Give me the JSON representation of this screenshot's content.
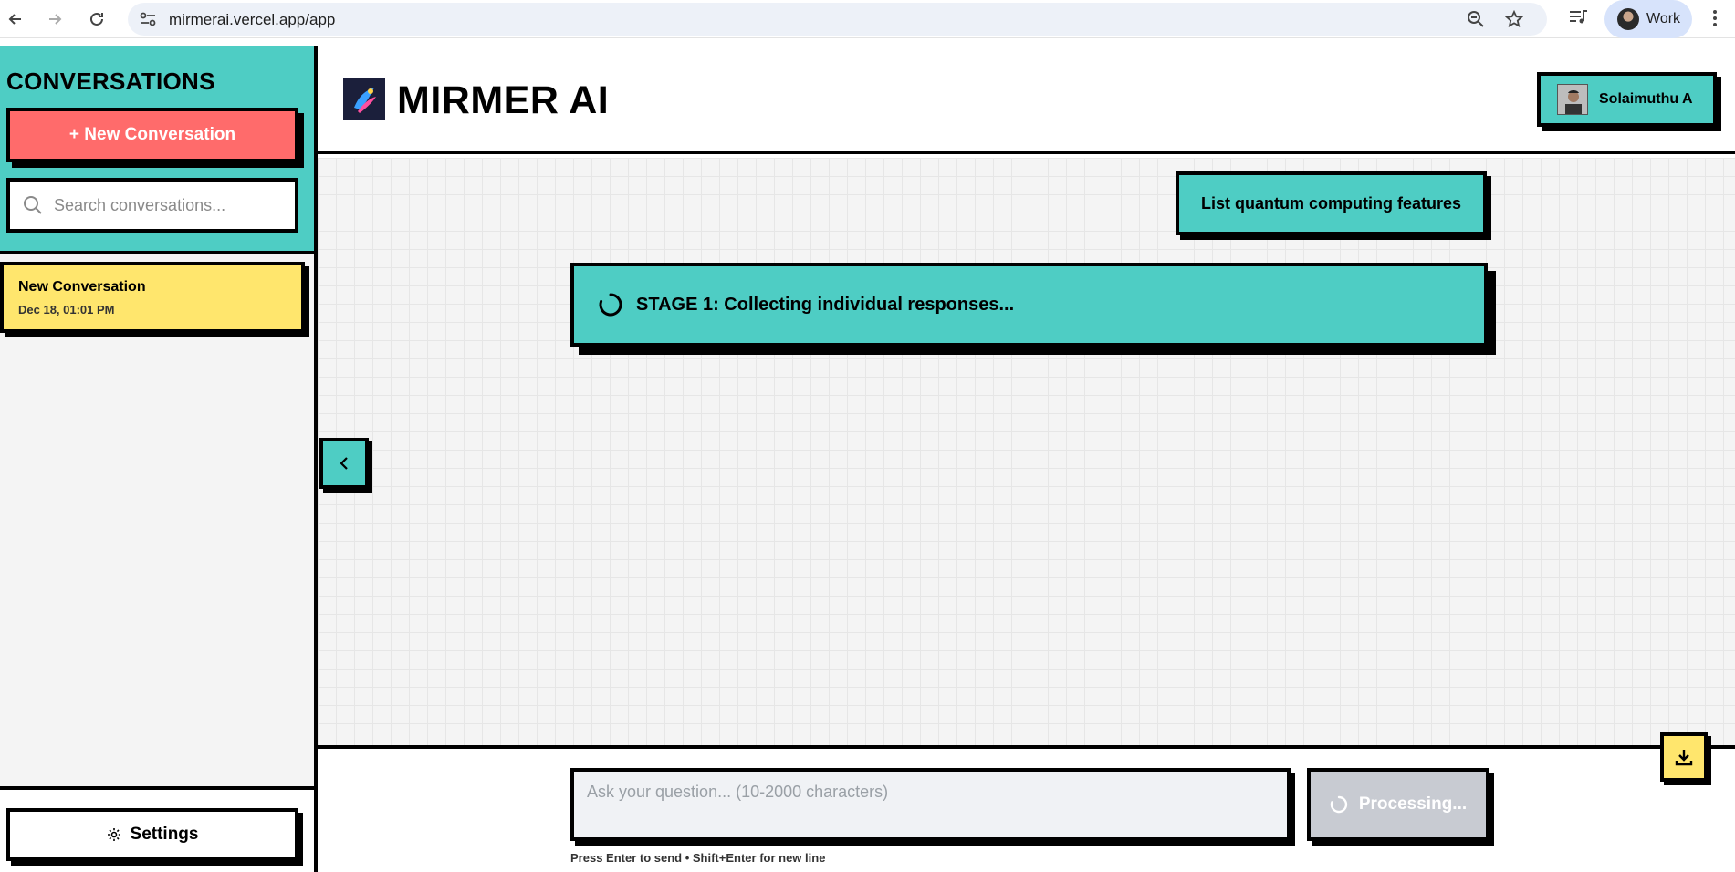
{
  "browser": {
    "url": "mirmerai.vercel.app/app",
    "profile_label": "Work"
  },
  "sidebar": {
    "title": "CONVERSATIONS",
    "new_conversation_label": "+ New Conversation",
    "search_placeholder": "Search conversations...",
    "conversations": [
      {
        "title": "New Conversation",
        "date": "Dec 18, 01:01 PM"
      }
    ],
    "settings_label": "Settings"
  },
  "header": {
    "app_title": "MIRMER AI",
    "user_name": "Solaimuthu A"
  },
  "chat": {
    "user_message": "List quantum computing features",
    "stage_status": "STAGE 1: Collecting individual responses..."
  },
  "composer": {
    "placeholder": "Ask your question... (10-2000 characters)",
    "submit_label": "Processing...",
    "hint": "Press Enter to send • Shift+Enter for new line"
  },
  "icons": {
    "back": "arrow-left-icon",
    "forward": "arrow-right-icon",
    "reload": "reload-icon",
    "site_settings": "tune-icon",
    "zoom": "zoom-icon",
    "bookmark": "star-icon",
    "media": "queue-music-icon",
    "menu": "kebab-icon",
    "search": "search-icon",
    "settings": "gear-icon",
    "collapse": "chevron-left-icon",
    "loading": "spinner-icon",
    "download": "download-icon"
  },
  "colors": {
    "teal": "#4ecdc4",
    "coral": "#ff6b6b",
    "yellow": "#ffe66d",
    "disabled": "#c8cbd2"
  }
}
